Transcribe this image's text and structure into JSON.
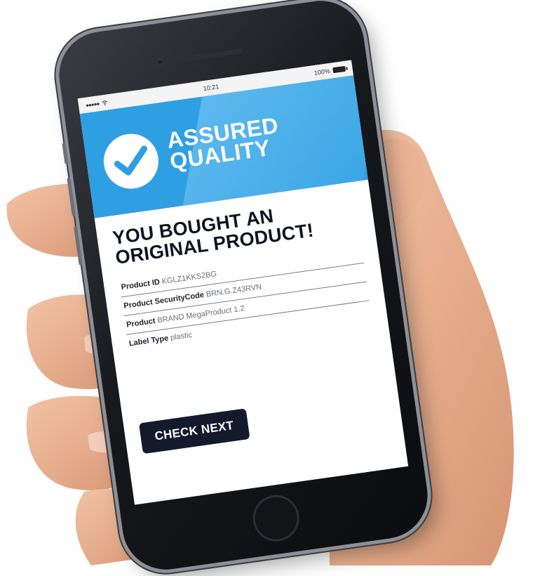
{
  "status_bar": {
    "signal": "●●●●●",
    "time": "10:21",
    "battery": "100%"
  },
  "header": {
    "brand_line1": "ASSURED",
    "brand_line2": "QUALITY"
  },
  "main": {
    "headline_line1": "YOU BOUGHT AN",
    "headline_line2": "ORIGINAL PRODUCT!",
    "rows": [
      {
        "label": "Product ID",
        "value": "KGLZ1KKS2BG"
      },
      {
        "label": "Product SecurityCode",
        "value": "BRN.G.Z43RVN"
      },
      {
        "label": "Product",
        "value": "BRAND MegaProduct 1.2"
      },
      {
        "label": "Label Type",
        "value": "plastic"
      }
    ],
    "button_label": "CHECK NEXT"
  },
  "colors": {
    "header_blue": "#2f9fe3",
    "button_navy": "#121a2c",
    "headline_text": "#101421"
  },
  "icons": [
    "check-circle-icon",
    "wifi-icon",
    "battery-icon"
  ]
}
